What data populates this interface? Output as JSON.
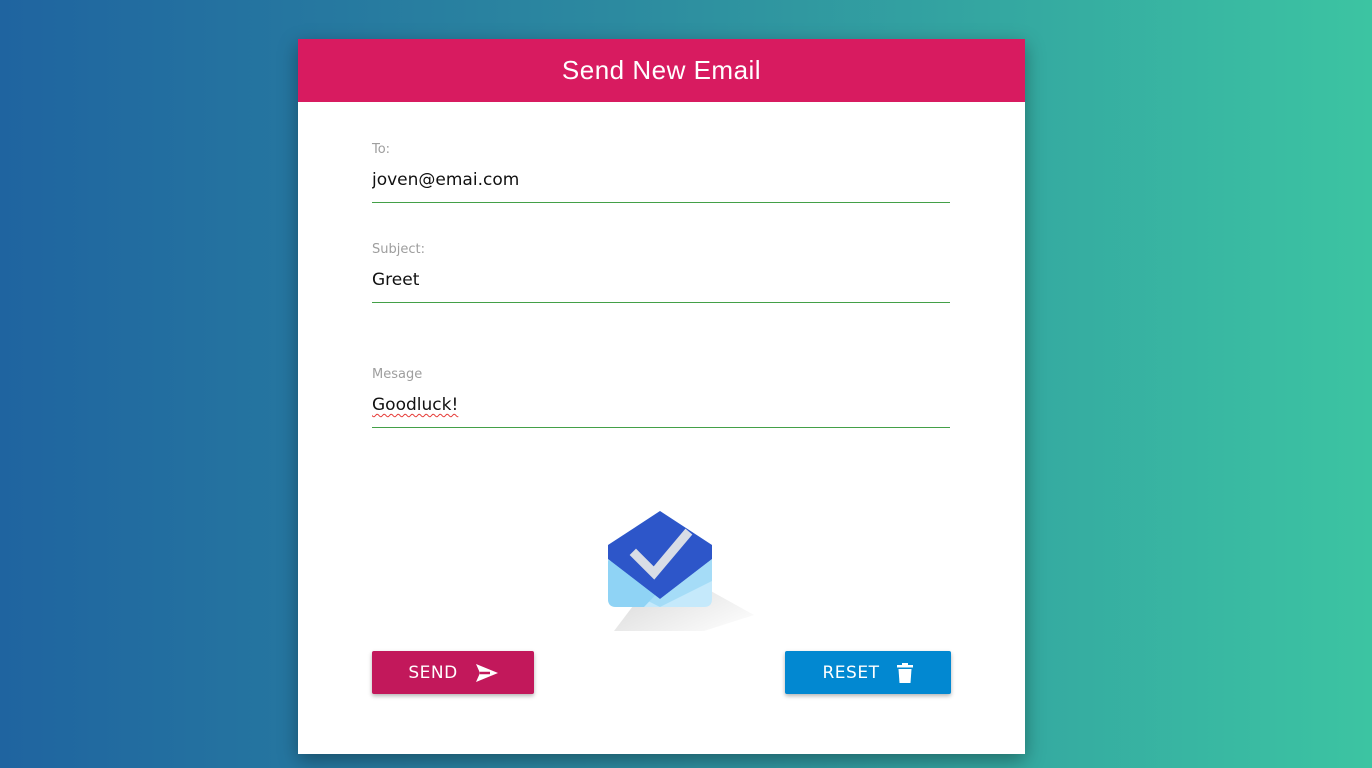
{
  "form": {
    "title": "Send New Email",
    "to_label": "To:",
    "to_value": "joven@emai.com",
    "subject_label": "Subject:",
    "subject_value": "Greet",
    "message_label": "Mesage",
    "message_value": "Goodluck!"
  },
  "buttons": {
    "send_label": "SEND",
    "send_icon": "send-icon",
    "reset_label": "RESET",
    "reset_icon": "trash-icon"
  },
  "logo": {
    "icon": "inbox-envelope-check-icon"
  },
  "colors": {
    "header": "#d81b60",
    "send_button": "#c2185b",
    "reset_button": "#0288d1",
    "input_underline": "#43a047"
  }
}
